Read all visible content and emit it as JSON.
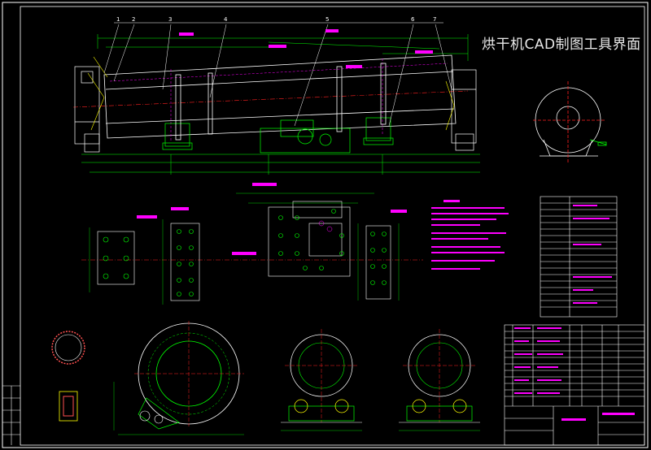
{
  "overlay_title": "烘干机CAD制图工具界面",
  "callouts": [
    "1",
    "2",
    "3",
    "4",
    "5",
    "6",
    "7"
  ],
  "colors": {
    "background": "#000000",
    "green": "#00ff00",
    "white": "#ffffff",
    "magenta": "#ff00ff",
    "cyan": "#00ffff",
    "red": "#ff2020",
    "yellow": "#ffff00"
  }
}
